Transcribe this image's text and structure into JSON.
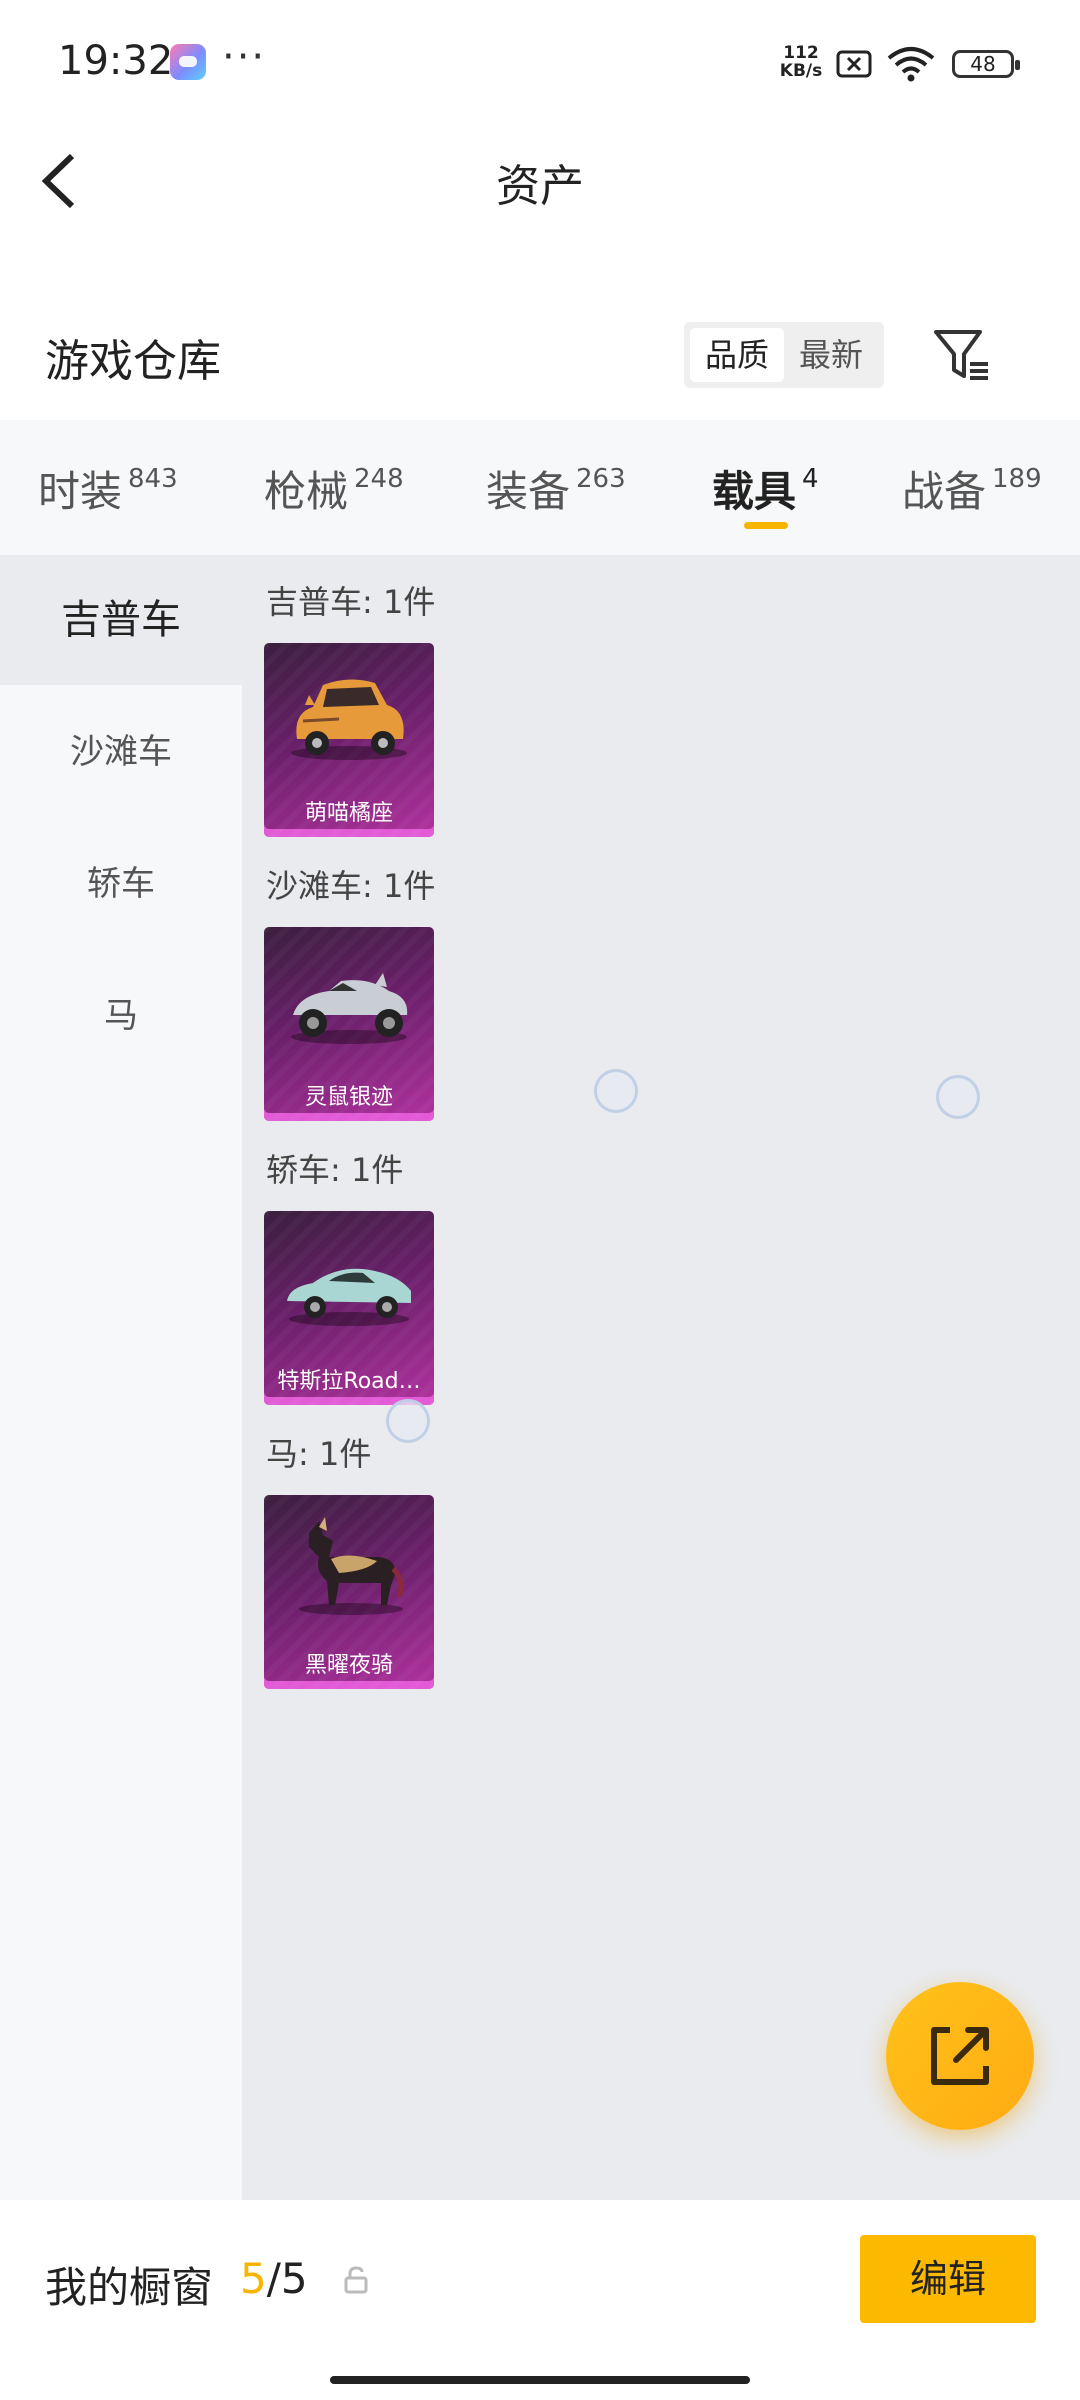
{
  "status_bar": {
    "time": "19:32",
    "more": "···",
    "net_speed_value": "112",
    "net_speed_unit": "KB/s",
    "battery": "48"
  },
  "header": {
    "title": "资产"
  },
  "warehouse": {
    "title": "游戏仓库",
    "sort_options": [
      "品质",
      "最新"
    ],
    "sort_selected": "品质"
  },
  "tabs": [
    {
      "label": "时装",
      "count": "843"
    },
    {
      "label": "枪械",
      "count": "248"
    },
    {
      "label": "装备",
      "count": "263"
    },
    {
      "label": "载具",
      "count": "4"
    },
    {
      "label": "战备",
      "count": "189"
    }
  ],
  "active_tab": "载具",
  "sidebar": {
    "items": [
      {
        "label": "吉普车"
      },
      {
        "label": "沙滩车"
      },
      {
        "label": "轿车"
      },
      {
        "label": "马"
      }
    ],
    "active": "吉普车"
  },
  "groups": [
    {
      "title": "吉普车: 1件",
      "items": [
        {
          "name": "萌喵橘座"
        }
      ]
    },
    {
      "title": "沙滩车: 1件",
      "items": [
        {
          "name": "灵鼠银迹"
        }
      ]
    },
    {
      "title": "轿车: 1件",
      "items": [
        {
          "name": "特斯拉Road…"
        }
      ]
    },
    {
      "title": "马: 1件",
      "items": [
        {
          "name": "黑曜夜骑"
        }
      ]
    }
  ],
  "showcase": {
    "label": "我的橱窗",
    "current": "5",
    "separator": "/",
    "total": "5",
    "edit_label": "编辑"
  },
  "colors": {
    "accent": "#fdb900",
    "card_purple": "#8a2a87"
  },
  "icons": [
    "back-arrow-icon",
    "filter-icon",
    "lock-icon",
    "share-external-icon"
  ]
}
